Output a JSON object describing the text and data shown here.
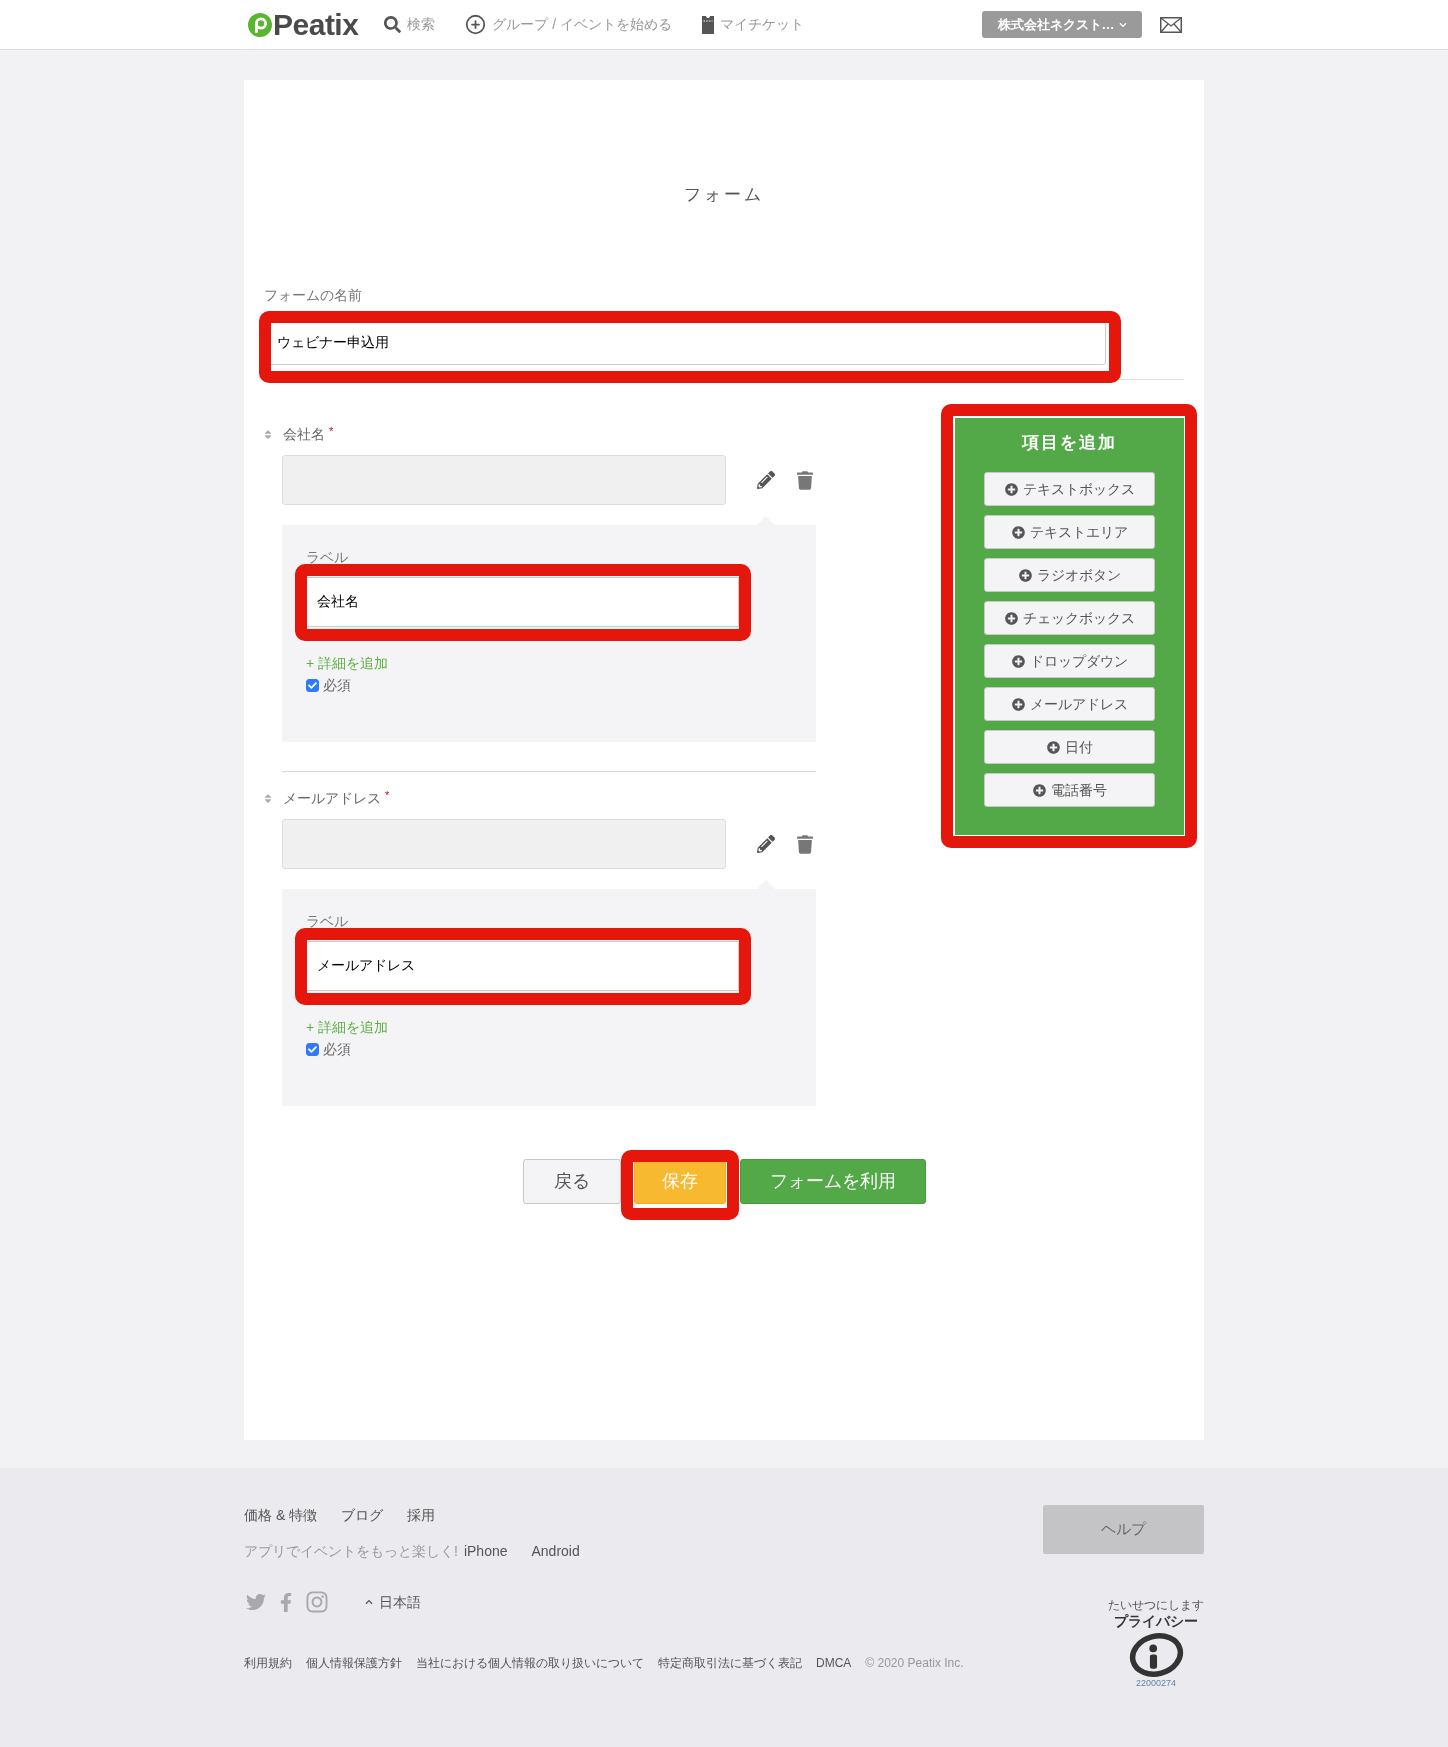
{
  "header": {
    "logo": "Peatix",
    "nav": [
      {
        "kind": "search",
        "label": "検索"
      },
      {
        "kind": "add",
        "label": "グループ / イベントを始める"
      },
      {
        "kind": "ticket",
        "label": "マイチケット"
      }
    ],
    "account": "株式会社ネクスト…"
  },
  "page_title": "フォーム",
  "form_name": {
    "label": "フォームの名前",
    "value": "ウェビナー申込用",
    "highlighted": true
  },
  "fields": [
    {
      "label": "会社名",
      "required_mark": "*",
      "editor": {
        "caption": "ラベル",
        "value": "会社名",
        "highlighted": true
      },
      "add_detail": "+ 詳細を追加",
      "required_option": {
        "label": "必須",
        "checked": true
      }
    },
    {
      "label": "メールアドレス",
      "required_mark": "*",
      "editor": {
        "caption": "ラベル",
        "value": "メールアドレス",
        "highlighted": true
      },
      "add_detail": "+ 詳細を追加",
      "required_option": {
        "label": "必須",
        "checked": true
      }
    }
  ],
  "add_panel": {
    "title": "項目を追加",
    "highlighted": true,
    "buttons": [
      "テキストボックス",
      "テキストエリア",
      "ラジオボタン",
      "チェックボックス",
      "ドロップダウン",
      "メールアドレス",
      "日付",
      "電話番号"
    ]
  },
  "actions": [
    {
      "kind": "back",
      "label": "戻る",
      "highlighted": false
    },
    {
      "kind": "save",
      "label": "保存",
      "highlighted": true
    },
    {
      "kind": "use",
      "label": "フォームを利用",
      "highlighted": false
    }
  ],
  "footer": {
    "links": [
      "価格 & 特徴",
      "ブログ",
      "採用"
    ],
    "app_promo": "アプリでイベントをもっと楽しく!",
    "app_links": [
      "iPhone",
      "Android"
    ],
    "language": "日本語",
    "legal_links": [
      "利用規約",
      "個人情報保護方針",
      "当社における個人情報の取り扱いについて",
      "特定商取引法に基づく表記",
      "DMCA"
    ],
    "copyright": "© 2020 Peatix Inc.",
    "help": "ヘルプ",
    "privacy_mark": {
      "arc_text": [
        "たいせつにします",
        "プライバシー"
      ],
      "number": "22000274"
    }
  }
}
